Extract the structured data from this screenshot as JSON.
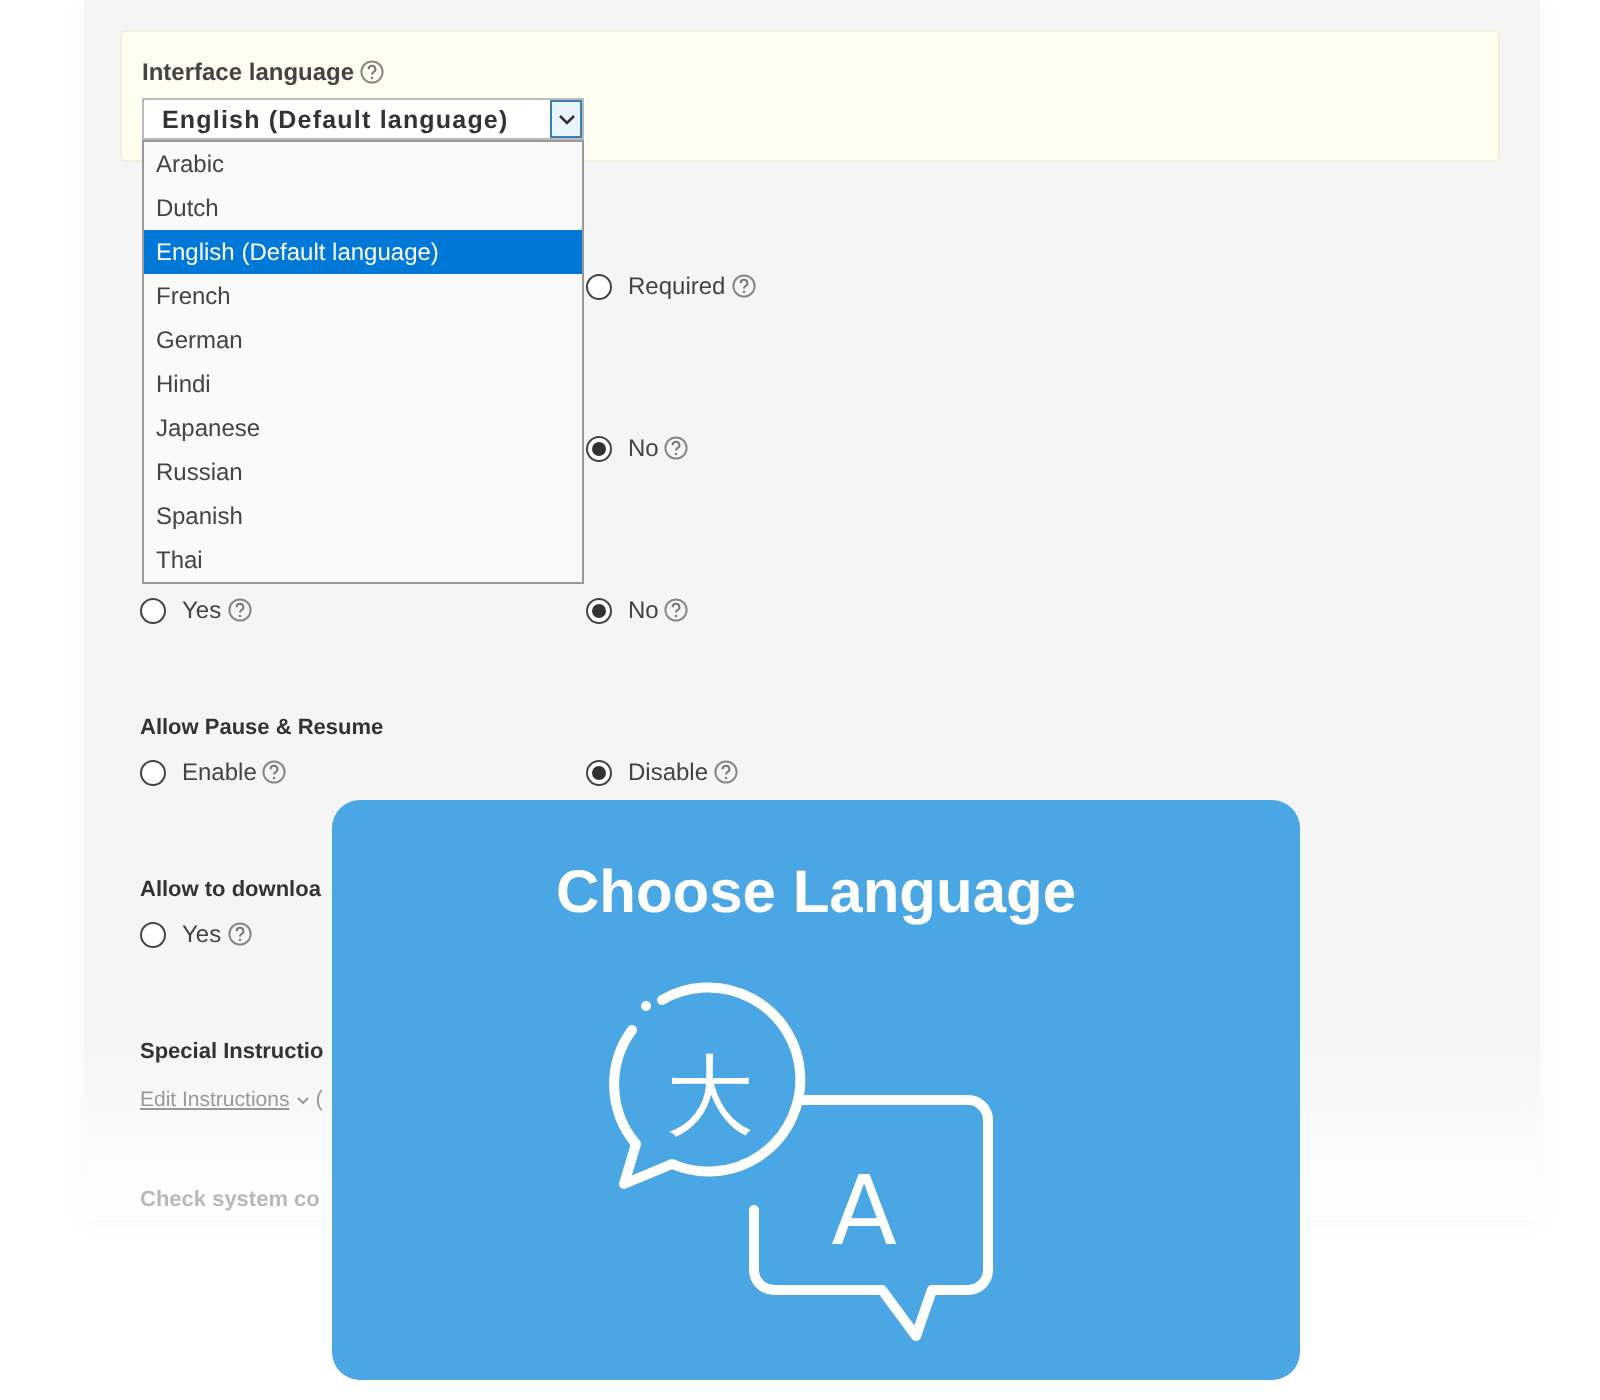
{
  "interface_language": {
    "label": "Interface language",
    "select": {
      "value": "English (Default language)",
      "expanded": true
    },
    "options": [
      {
        "label": "Arabic",
        "selected": false
      },
      {
        "label": "Dutch",
        "selected": false
      },
      {
        "label": "English (Default language)",
        "selected": true
      },
      {
        "label": "French",
        "selected": false
      },
      {
        "label": "German",
        "selected": false
      },
      {
        "label": "Hindi",
        "selected": false
      },
      {
        "label": "Japanese",
        "selected": false
      },
      {
        "label": "Russian",
        "selected": false
      },
      {
        "label": "Spanish",
        "selected": false
      },
      {
        "label": "Thai",
        "selected": false
      }
    ]
  },
  "sections": [
    {
      "right_option": {
        "label": "Required",
        "selected": false
      }
    },
    {
      "right_option": {
        "label": "No",
        "selected": true
      }
    },
    {
      "left_option": {
        "label": "Yes",
        "selected": false
      },
      "right_option": {
        "label": "No",
        "selected": true
      }
    },
    {
      "title": "Allow Pause & Resume",
      "left_option": {
        "label": "Enable",
        "selected": false
      },
      "right_option": {
        "label": "Disable",
        "selected": true
      }
    },
    {
      "title": "Allow to downloa",
      "left_option": {
        "label": "Yes",
        "selected": false
      }
    },
    {
      "title": "Special Instructio",
      "link": "Edit Instructions",
      "note": "("
    },
    {
      "title": "Check system co",
      "faded": true
    }
  ],
  "overlay": {
    "title": "Choose Language",
    "bubble_texts": [
      "大",
      "A"
    ]
  }
}
